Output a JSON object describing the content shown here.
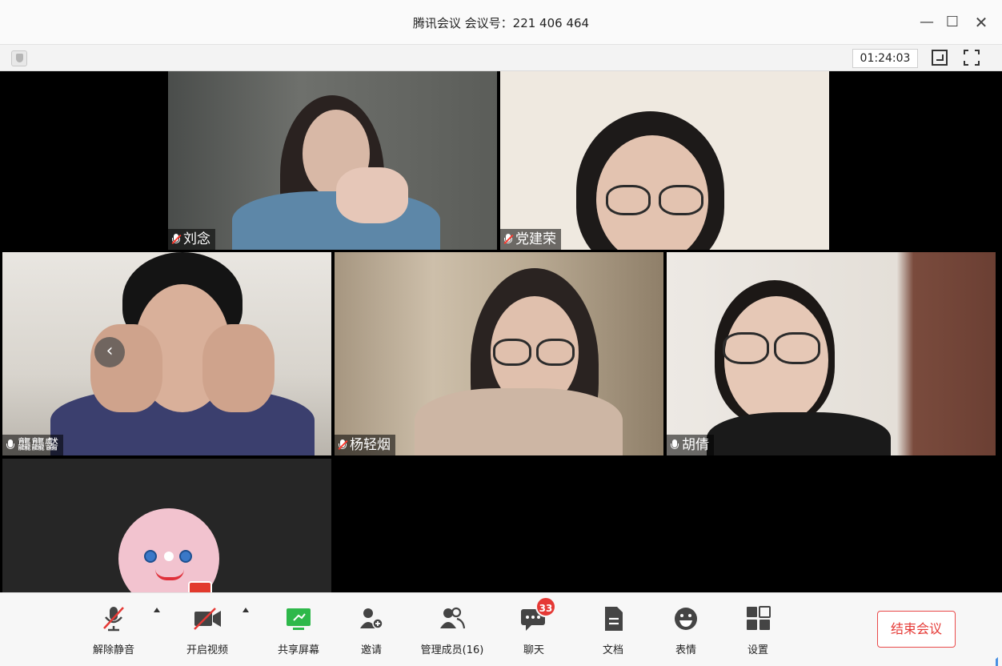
{
  "window": {
    "title": "腾讯会议 会议号：221 406 464",
    "minimize_glyph": "—",
    "maximize_glyph": "☐",
    "close_glyph": "✕"
  },
  "subbar": {
    "timer": "01:24:03",
    "icons": [
      "shield-icon",
      "layout-toggle-icon",
      "fullscreen-icon"
    ]
  },
  "participants": [
    {
      "name": "刘念",
      "muted": true
    },
    {
      "name": "党建荣",
      "muted": true
    },
    {
      "name": "龘龘齾",
      "muted": false
    },
    {
      "name": "杨轻烟",
      "muted": true
    },
    {
      "name": "胡倩",
      "muted": false
    },
    {
      "name": "",
      "video": false
    }
  ],
  "stage": {
    "prev_glyph": "‹"
  },
  "toolbar": {
    "items": [
      {
        "label": "解除静音",
        "icon": "mic-muted-icon"
      },
      {
        "label": "开启视频",
        "icon": "video-off-icon"
      },
      {
        "label": "共享屏幕",
        "icon": "screen-share-icon"
      },
      {
        "label": "邀请",
        "icon": "invite-user-icon"
      },
      {
        "label": "管理成员(16)",
        "icon": "members-icon"
      },
      {
        "label": "聊天",
        "icon": "chat-icon",
        "badge": "33"
      },
      {
        "label": "文档",
        "icon": "document-icon"
      },
      {
        "label": "表情",
        "icon": "emoji-icon"
      },
      {
        "label": "设置",
        "icon": "settings-icon"
      }
    ],
    "end_meeting": "结束会议"
  },
  "colors": {
    "accent_green": "#2eb84a",
    "danger": "#e53935",
    "muted_red": "#ff3b30"
  }
}
